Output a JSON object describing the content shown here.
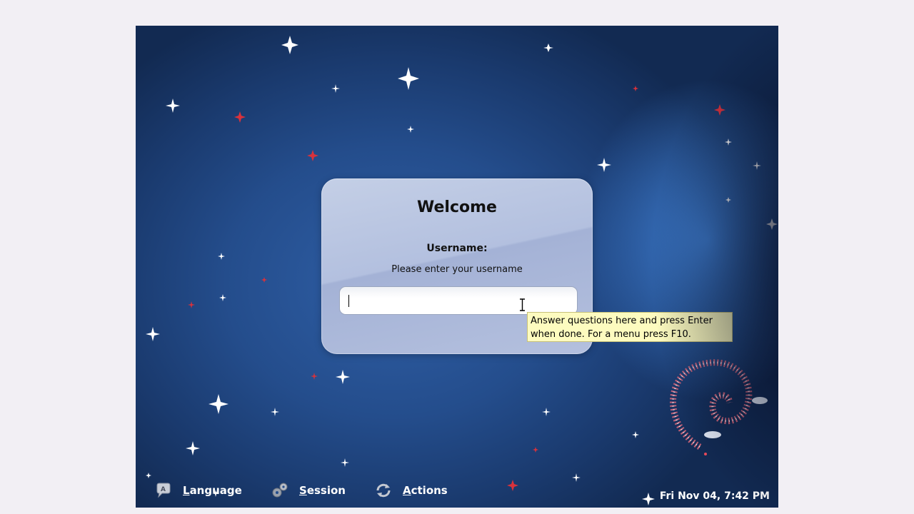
{
  "login": {
    "title": "Welcome",
    "username_label": "Username:",
    "prompt": "Please enter your username",
    "input_value": ""
  },
  "tooltip": {
    "line1": "Answer questions here and press Enter",
    "line2": "when done.  For a menu press F10."
  },
  "bottom_bar": {
    "language": {
      "accel": "L",
      "rest": "anguage",
      "icon": "language-icon"
    },
    "session": {
      "accel": "S",
      "rest": "ession",
      "icon": "gear-icon"
    },
    "actions": {
      "accel": "A",
      "rest": "ctions",
      "icon": "refresh-icon"
    },
    "clock": "Fri Nov 04,  7:42 PM"
  },
  "colors": {
    "background_blue": "#244d8c",
    "card": "#b3c0df",
    "tooltip_bg": "#fdfbbf",
    "star_red": "#d8323c"
  }
}
